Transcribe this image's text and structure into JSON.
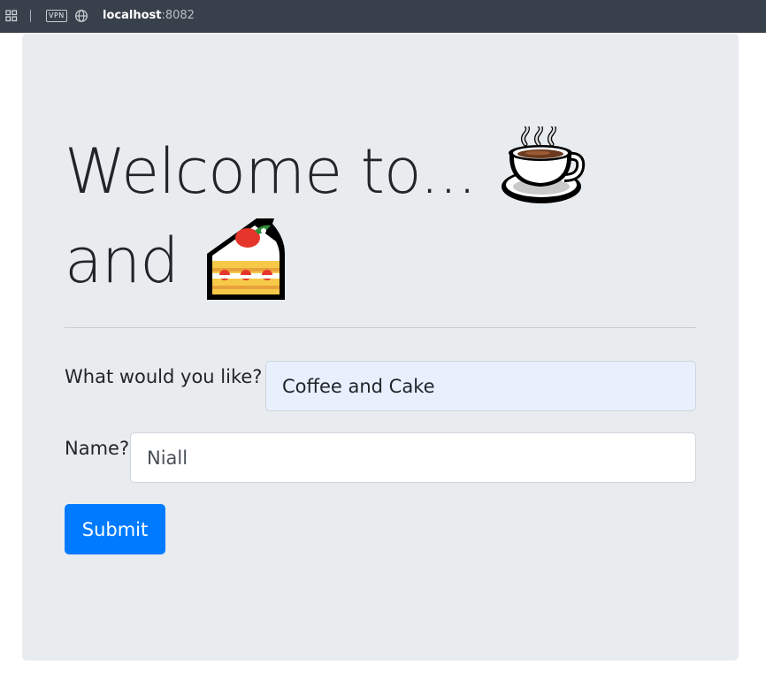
{
  "browser": {
    "url_host": "localhost",
    "url_port": ":8082",
    "vpn_badge": "VPN",
    "icons": [
      "tabs-grid-icon",
      "vpn-icon",
      "globe-icon"
    ]
  },
  "hero": {
    "line1_text": "Welcome to...",
    "line2_text": "and",
    "emoji_1": "hot-beverage-emoji",
    "emoji_2": "shortcake-emoji"
  },
  "form": {
    "what_label": "What would you like?",
    "what_value": "Coffee and Cake",
    "name_label": "Name?",
    "name_value": "Niall",
    "submit_label": "Submit"
  },
  "colors": {
    "jumbotron_bg": "#e9ecef",
    "primary_button": "#007bff",
    "autofill_bg": "#e8f0fe",
    "topbar_bg": "#38414b"
  }
}
